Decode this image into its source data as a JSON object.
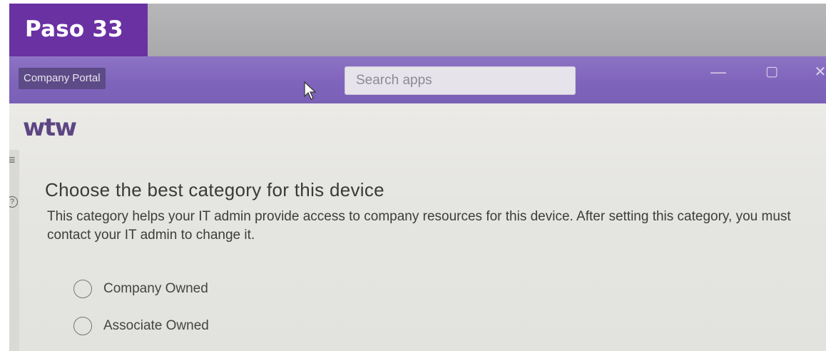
{
  "step_badge": {
    "label": "Paso 33",
    "color": "#6a31a3"
  },
  "window": {
    "app_title": "Company Portal",
    "search_placeholder": "Search apps",
    "controls": {
      "minimize_icon": "minimize-icon",
      "maximize_icon": "maximize-icon",
      "close_icon": "close-icon"
    },
    "titlebar_color": "#7f64bb"
  },
  "brand": {
    "logo_text": "wtw",
    "logo_color": "#5d4582"
  },
  "sidebar": {
    "menu_icon": "hamburger-menu-icon",
    "help_icon": "help-icon"
  },
  "main": {
    "heading": "Choose the best category for this device",
    "description": "This category helps your IT admin provide access to company resources for this device. After setting this category, you must contact your IT admin to change it.",
    "options": [
      {
        "label": "Company Owned",
        "selected": false
      },
      {
        "label": "Associate Owned",
        "selected": false
      }
    ]
  }
}
